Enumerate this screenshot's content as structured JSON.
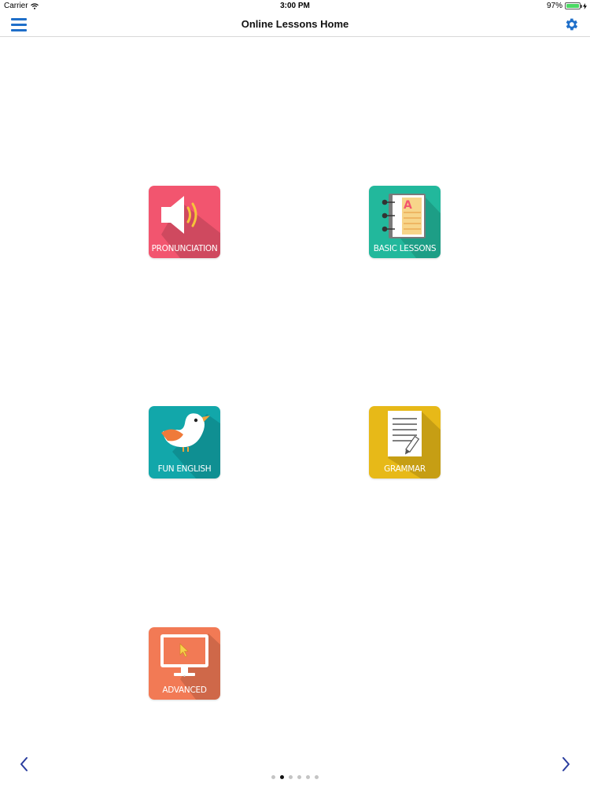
{
  "status_bar": {
    "carrier": "Carrier",
    "time": "3:00 PM",
    "battery_percent": "97%",
    "battery_level": 0.97,
    "wifi_icon": "wifi-icon",
    "charging_icon": "charging-bolt-icon"
  },
  "nav": {
    "title": "Online Lessons Home",
    "menu_icon": "hamburger-menu-icon",
    "settings_icon": "gear-icon",
    "accent_color": "#1f6fc9"
  },
  "lessons": [
    {
      "label": "PRONUNCIATION",
      "color": "#f2556f",
      "icon": "speaker-icon"
    },
    {
      "label": "BASIC LESSONS",
      "color": "#22b89c",
      "icon": "notebook-icon"
    },
    {
      "label": "FUN ENGLISH",
      "color": "#12a7aa",
      "icon": "bird-icon"
    },
    {
      "label": "GRAMMAR",
      "color": "#e7b918",
      "icon": "document-pencil-icon"
    },
    {
      "label": "ADVANCED",
      "color": "#f27a55",
      "icon": "computer-monitor-icon"
    }
  ],
  "pager": {
    "prev_icon": "chevron-left-icon",
    "next_icon": "chevron-right-icon",
    "page_count": 6,
    "current_page": 2
  }
}
